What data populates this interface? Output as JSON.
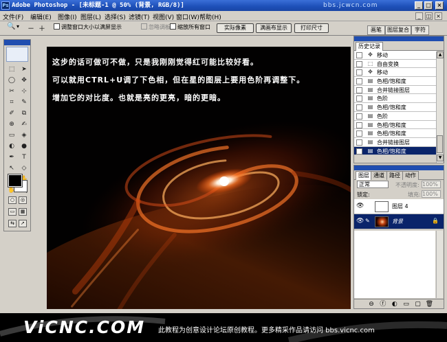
{
  "app": {
    "title": "Adobe Photoshop - [未标题-1 @ 50% (背景, RGB/8)]",
    "title_watermark": "bbs.jcwcn.com",
    "icon_text": "Ps"
  },
  "window_controls": {
    "minimize": "_",
    "maximize": "□",
    "close": "×"
  },
  "menu": [
    "文件(F)",
    "编辑(E)",
    "图像(I)",
    "图层(L)",
    "选择(S)",
    "滤镜(T)",
    "视图(V)",
    "窗口(W)",
    "帮助(H)"
  ],
  "menu_controls": {
    "minimize": "_",
    "restore": "◫",
    "close": "×"
  },
  "options": {
    "zoom_icon": "🔍",
    "dropdown": "▾",
    "minus": "－",
    "plus": "＋",
    "resize_window": "调整窗口大小以满屏显示",
    "ignore_palettes": "忽略调板",
    "zoom_all": "缩放所有窗口",
    "actual_pixels": "实际像素",
    "fit_on_screen": "满画布显示",
    "print_size": "打印尺寸"
  },
  "palette_well": [
    "画笔",
    "图层复合",
    "字符"
  ],
  "toolbox": {
    "tools": [
      "⬚",
      "➤",
      "◯",
      "✥",
      "✂",
      "⊹",
      "⌗",
      "✎",
      "✐",
      "⧉",
      "⊕",
      "✍",
      "▭",
      "◈",
      "◐",
      "●",
      "✒",
      "T",
      "↖",
      "◇",
      "☐",
      "✋",
      "✋",
      "🔍"
    ],
    "mode_icons": [
      "○",
      "◎",
      "▭",
      "▦",
      "⇆",
      "➚"
    ]
  },
  "canvas": {
    "lines": [
      "这步的话可做可不做，只是我刚刚觉得红可能比较好看。",
      "可以就用CTRL+U调了下色相，但在星的图层上要用色阶再调整下。",
      "增加它的对比度。也就是亮的更亮，暗的更暗。"
    ],
    "colors": {
      "galaxy_core": "#fff6e8",
      "galaxy_arm": "#ff6a1a",
      "galaxy_dark": "#7a1c04"
    }
  },
  "history": {
    "tab": "历史记录",
    "items": [
      {
        "icon": "✥",
        "label": "移动"
      },
      {
        "icon": "⬚",
        "label": "自由变换"
      },
      {
        "icon": "✥",
        "label": "移动"
      },
      {
        "icon": "▤",
        "label": "色相/饱和度"
      },
      {
        "icon": "▤",
        "label": "合并链接图层"
      },
      {
        "icon": "▤",
        "label": "色阶"
      },
      {
        "icon": "▤",
        "label": "色相/饱和度"
      },
      {
        "icon": "▤",
        "label": "色阶"
      },
      {
        "icon": "▤",
        "label": "色相/饱和度"
      },
      {
        "icon": "▤",
        "label": "色相/饱和度"
      },
      {
        "icon": "▤",
        "label": "合并链接图层"
      },
      {
        "icon": "▤",
        "label": "色相/饱和度"
      }
    ],
    "scroll": {
      "up": "▲",
      "down": "▼"
    }
  },
  "layers": {
    "tabs": [
      "图层",
      "通道",
      "路径",
      "动作"
    ],
    "blend_mode": "正常",
    "opacity_label": "不透明度:",
    "opacity_value": "100%",
    "lock_label": "锁定:",
    "fill_label": "填充:",
    "fill_value": "100%",
    "items": [
      {
        "name": "图层 4",
        "visible_icon": "👁",
        "link_icon": "",
        "lock_icon": ""
      },
      {
        "name": "背景",
        "visible_icon": "👁",
        "link_icon": "✎",
        "lock_icon": "🔒"
      }
    ],
    "bottom_icons": [
      "⊖",
      "ⓕ",
      "◐",
      "▭",
      "▢",
      "🗑"
    ]
  },
  "footer": {
    "logo": "ViCNC.COM",
    "text": "此教程为创意设计论坛原创教程。更多精采作品请访问 bbs.vicnc.com"
  }
}
